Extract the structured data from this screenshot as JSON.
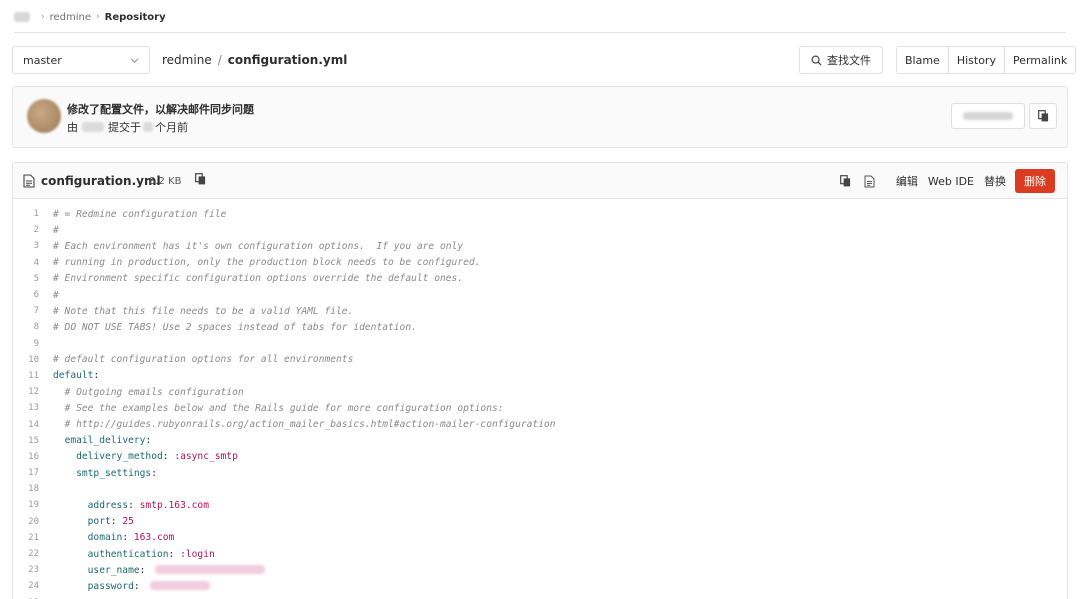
{
  "breadcrumb": {
    "project": "redmine",
    "current": "Repository",
    "separator": "›"
  },
  "branch": {
    "name": "master"
  },
  "path": {
    "project": "redmine",
    "separator": "/",
    "file": "configuration.yml"
  },
  "find_file": {
    "label": "查找文件",
    "icon": "search-icon"
  },
  "view_buttons": [
    {
      "label": "Blame"
    },
    {
      "label": "History"
    },
    {
      "label": "Permalink"
    }
  ],
  "commit": {
    "title": "修改了配置文件，以解决邮件同步问题",
    "meta_prefix": "由",
    "meta_middle": "提交于",
    "meta_suffix": "个月前"
  },
  "file": {
    "name": "configuration.yml",
    "size": "8.2 KB",
    "actions": {
      "edit": "编辑",
      "web_ide": "Web IDE",
      "replace": "替换",
      "delete": "删除"
    }
  },
  "code_lines": [
    {
      "n": "1",
      "segments": [
        {
          "t": "comment",
          "v": "# = Redmine configuration file"
        }
      ]
    },
    {
      "n": "2",
      "segments": [
        {
          "t": "comment",
          "v": "#"
        }
      ]
    },
    {
      "n": "3",
      "segments": [
        {
          "t": "comment",
          "v": "# Each environment has it's own configuration options.  If you are only"
        }
      ]
    },
    {
      "n": "4",
      "segments": [
        {
          "t": "comment",
          "v": "# running in production, only the production block needs to be configured."
        }
      ]
    },
    {
      "n": "5",
      "segments": [
        {
          "t": "comment",
          "v": "# Environment specific configuration options override the default ones."
        }
      ]
    },
    {
      "n": "6",
      "segments": [
        {
          "t": "comment",
          "v": "#"
        }
      ]
    },
    {
      "n": "7",
      "segments": [
        {
          "t": "comment",
          "v": "# Note that this file needs to be a valid YAML file."
        }
      ]
    },
    {
      "n": "8",
      "segments": [
        {
          "t": "comment",
          "v": "# DO NOT USE TABS! Use 2 spaces instead of tabs for identation."
        }
      ]
    },
    {
      "n": "9",
      "segments": []
    },
    {
      "n": "10",
      "segments": [
        {
          "t": "comment",
          "v": "# default configuration options for all environments"
        }
      ]
    },
    {
      "n": "11",
      "segments": [
        {
          "t": "key",
          "v": "default"
        },
        {
          "t": "plain",
          "v": ":"
        }
      ]
    },
    {
      "n": "12",
      "segments": [
        {
          "t": "plain",
          "v": "  "
        },
        {
          "t": "comment",
          "v": "# Outgoing emails configuration"
        }
      ]
    },
    {
      "n": "13",
      "segments": [
        {
          "t": "plain",
          "v": "  "
        },
        {
          "t": "comment",
          "v": "# See the examples below and the Rails guide for more configuration options:"
        }
      ]
    },
    {
      "n": "14",
      "segments": [
        {
          "t": "plain",
          "v": "  "
        },
        {
          "t": "comment",
          "v": "# http://guides.rubyonrails.org/action_mailer_basics.html#action-mailer-configuration"
        }
      ]
    },
    {
      "n": "15",
      "segments": [
        {
          "t": "plain",
          "v": "  "
        },
        {
          "t": "key",
          "v": "email_delivery"
        },
        {
          "t": "plain",
          "v": ":"
        }
      ]
    },
    {
      "n": "16",
      "segments": [
        {
          "t": "plain",
          "v": "    "
        },
        {
          "t": "key",
          "v": "delivery_method"
        },
        {
          "t": "plain",
          "v": ": "
        },
        {
          "t": "val",
          "v": ":async_smtp"
        }
      ]
    },
    {
      "n": "17",
      "segments": [
        {
          "t": "plain",
          "v": "    "
        },
        {
          "t": "key",
          "v": "smtp_settings"
        },
        {
          "t": "plain",
          "v": ":"
        }
      ]
    },
    {
      "n": "18",
      "segments": []
    },
    {
      "n": "19",
      "segments": [
        {
          "t": "plain",
          "v": "      "
        },
        {
          "t": "key",
          "v": "address"
        },
        {
          "t": "plain",
          "v": ": "
        },
        {
          "t": "val",
          "v": "smtp.163.com"
        }
      ]
    },
    {
      "n": "20",
      "segments": [
        {
          "t": "plain",
          "v": "      "
        },
        {
          "t": "key",
          "v": "port"
        },
        {
          "t": "plain",
          "v": ": "
        },
        {
          "t": "val",
          "v": "25"
        }
      ]
    },
    {
      "n": "21",
      "segments": [
        {
          "t": "plain",
          "v": "      "
        },
        {
          "t": "key",
          "v": "domain"
        },
        {
          "t": "plain",
          "v": ": "
        },
        {
          "t": "val",
          "v": "163.com"
        }
      ]
    },
    {
      "n": "22",
      "segments": [
        {
          "t": "plain",
          "v": "      "
        },
        {
          "t": "key",
          "v": "authentication"
        },
        {
          "t": "plain",
          "v": ": "
        },
        {
          "t": "val",
          "v": ":login"
        }
      ]
    },
    {
      "n": "23",
      "segments": [
        {
          "t": "plain",
          "v": "      "
        },
        {
          "t": "key",
          "v": "user_name"
        },
        {
          "t": "plain",
          "v": ":"
        },
        {
          "t": "redacted",
          "v": ""
        }
      ]
    },
    {
      "n": "24",
      "segments": [
        {
          "t": "plain",
          "v": "      "
        },
        {
          "t": "key",
          "v": "password"
        },
        {
          "t": "plain",
          "v": ":"
        },
        {
          "t": "redacted-short",
          "v": ""
        }
      ]
    },
    {
      "n": "25",
      "segments": []
    }
  ]
}
